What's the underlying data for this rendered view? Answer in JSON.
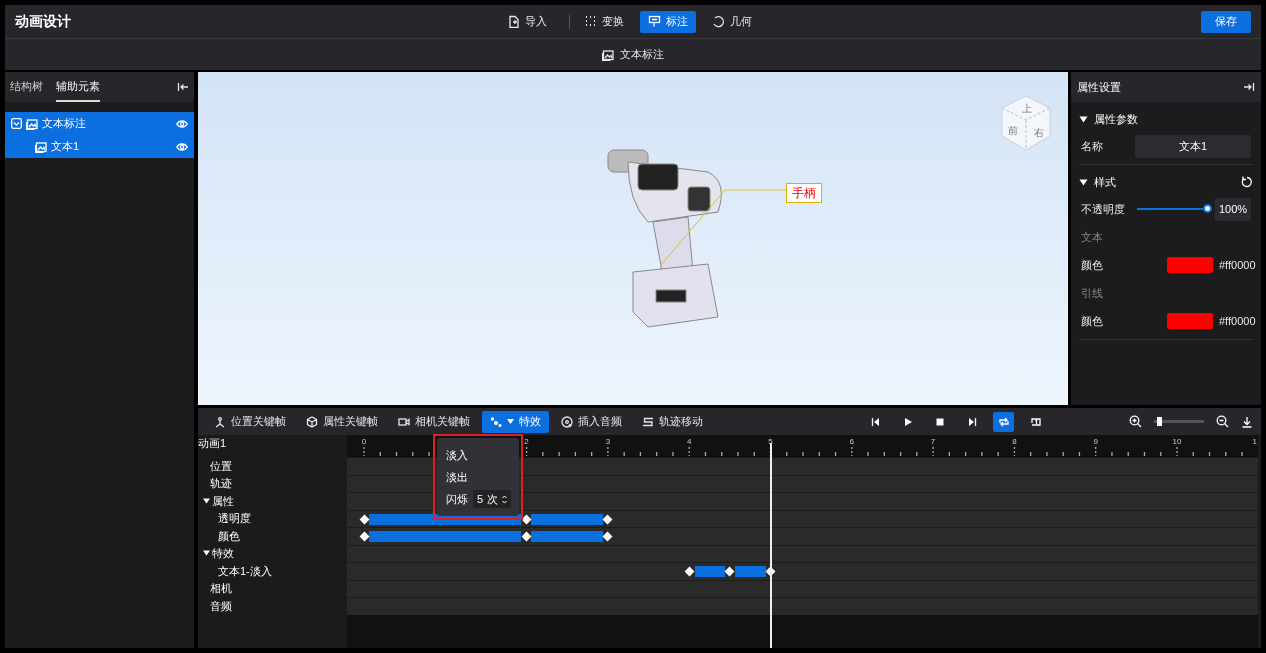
{
  "app": {
    "title": "动画设计",
    "save": "保存"
  },
  "toolbar": [
    {
      "kind": "import",
      "label": "导入",
      "selected": false
    },
    {
      "kind": "transform",
      "label": "变换",
      "selected": false
    },
    {
      "kind": "annotate",
      "label": "标注",
      "selected": true
    },
    {
      "kind": "geometry",
      "label": "几何",
      "selected": false
    }
  ],
  "subtoolbar": {
    "label": "文本标注"
  },
  "left_panel": {
    "tabs": [
      {
        "label": "结构树",
        "selected": false
      },
      {
        "label": "辅助元素",
        "selected": true
      }
    ],
    "tree": [
      {
        "label": "文本标注",
        "expanded": true,
        "selected": true,
        "children": [
          {
            "label": "文本1",
            "selected": true
          }
        ]
      }
    ]
  },
  "viewport": {
    "annotation": "手柄",
    "view_cube": [
      "上",
      "前",
      "右"
    ]
  },
  "properties": {
    "title": "属性设置",
    "param_section": "属性参数",
    "name_label": "名称",
    "name_value": "文本1",
    "style_section": "样式",
    "opacity_label": "不透明度",
    "opacity": {
      "level": 1,
      "reading": "100%"
    },
    "colors": [
      {
        "heading": "文本",
        "label": "颜色",
        "color": "#ff0000",
        "value": "#ff0000"
      },
      {
        "heading": "引线",
        "label": "颜色",
        "color": "#ff0000",
        "value": "#ff0000"
      }
    ]
  },
  "timeline": {
    "tools": [
      {
        "kind": "position",
        "label": "位置关键帧",
        "selected": false
      },
      {
        "kind": "property",
        "label": "属性关键帧",
        "selected": false
      },
      {
        "kind": "camera",
        "label": "相机关键帧",
        "selected": false
      },
      {
        "kind": "effect",
        "label": "特效",
        "selected": true
      },
      {
        "kind": "audio",
        "label": "插入音频",
        "selected": false
      },
      {
        "kind": "path",
        "label": "轨迹移动",
        "selected": false
      }
    ],
    "playback": [
      {
        "kind": "prev",
        "selected": false
      },
      {
        "kind": "play",
        "selected": false
      },
      {
        "kind": "stop",
        "selected": false
      },
      {
        "kind": "next",
        "selected": false
      },
      {
        "kind": "loop",
        "selected": true
      },
      {
        "kind": "loop-once",
        "selected": false
      }
    ],
    "zoom": {
      "level": 0.1
    },
    "animation_name": "动画1",
    "ticks": [
      "0"
    ],
    "ticks_after_menu": [
      "2",
      "3",
      "4",
      "5",
      "6",
      "7",
      "8",
      "9",
      "10",
      "1"
    ],
    "playhead": {
      "level": 0.465
    },
    "rows": [
      {
        "label": "位置"
      },
      {
        "label": "轨迹"
      },
      {
        "label": "属性",
        "expanded": true,
        "children": [
          {
            "label": "透明度",
            "keyframes": [
              {
                "level": 0.0187
              },
              {
                "level": 0.197
              },
              {
                "level": 0.286
              }
            ]
          },
          {
            "label": "颜色",
            "keyframes": [
              {
                "level": 0.0187
              },
              {
                "level": 0.197
              },
              {
                "level": 0.286
              }
            ]
          }
        ]
      },
      {
        "label": "特效",
        "expanded": true,
        "children": [
          {
            "label": "文本1-淡入",
            "keyframes": [
              {
                "level": 0.376
              },
              {
                "level": 0.42
              },
              {
                "level": 0.465
              }
            ]
          }
        ]
      },
      {
        "label": "相机"
      },
      {
        "label": "音频"
      }
    ],
    "effect_menu": {
      "highlighted": true,
      "items": [
        {
          "label": "淡入"
        },
        {
          "label": "淡出"
        },
        {
          "label": "闪烁",
          "count": "5",
          "unit": "次"
        }
      ]
    }
  }
}
